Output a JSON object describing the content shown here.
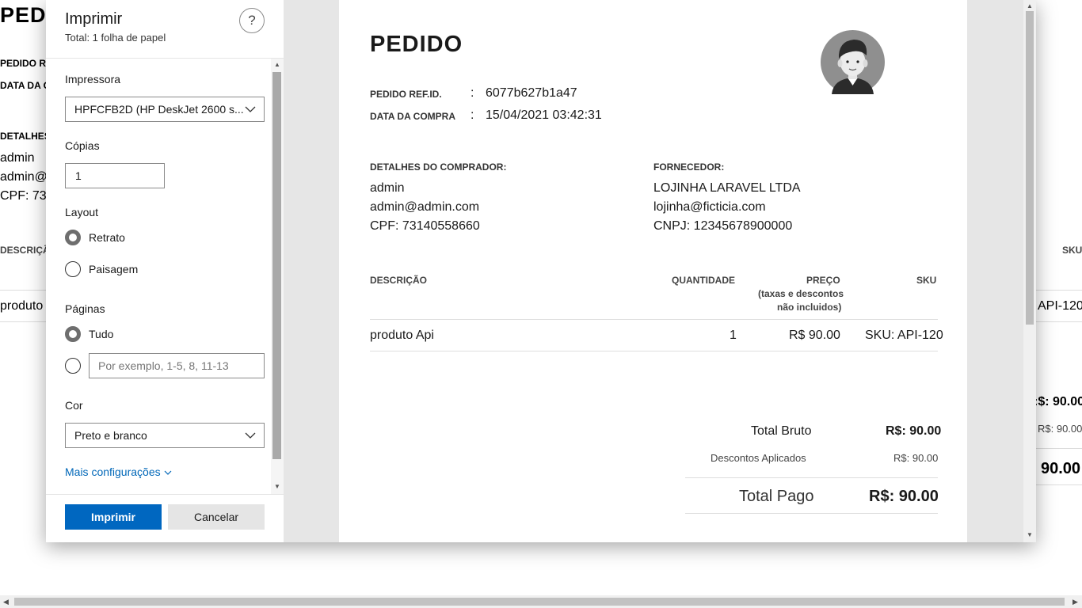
{
  "background_page": {
    "title": "PED",
    "ref_label": "PEDIDO R",
    "date_label": "DATA DA C",
    "buyer_label": "DETALHES",
    "buyer_name": "admin",
    "buyer_email": "admin@",
    "buyer_cpf": "CPF: 731",
    "desc_header": "DESCRIÇÃ",
    "sku_header": "SKU",
    "row_product": "produto",
    "row_sku": "API-120",
    "total_bruto": ":$: 90.00",
    "descontos": "R$: 90.00",
    "total_pago": "90.00"
  },
  "dialog": {
    "title": "Imprimir",
    "subtitle": "Total: 1 folha de papel",
    "help": "?",
    "printer_label": "Impressora",
    "printer_value": "HPFCFB2D (HP DeskJet 2600 s...",
    "copies_label": "Cópias",
    "copies_value": "1",
    "layout_label": "Layout",
    "layout_options": [
      "Retrato",
      "Paisagem"
    ],
    "layout_selected": "Retrato",
    "pages_label": "Páginas",
    "pages_all": "Tudo",
    "pages_placeholder": "Por exemplo, 1-5, 8, 11-13",
    "color_label": "Cor",
    "color_value": "Preto e branco",
    "more_settings": "Mais configurações",
    "print_button": "Imprimir",
    "cancel_button": "Cancelar"
  },
  "preview": {
    "title": "PEDIDO",
    "ref_label": "PEDIDO REF.ID.",
    "ref_value": "6077b627b1a47",
    "date_label": "DATA DA COMPRA",
    "date_value": "15/04/2021 03:42:31",
    "colon": ":",
    "buyer": {
      "label": "DETALHES DO COMPRADOR:",
      "name": "admin",
      "email": "admin@admin.com",
      "doc": "CPF: 73140558660"
    },
    "supplier": {
      "label": "FORNECEDOR:",
      "name": "LOJINHA LARAVEL LTDA",
      "email": "lojinha@ficticia.com",
      "doc": "CNPJ: 12345678900000"
    },
    "table": {
      "headers": {
        "description": "DESCRIÇÃO",
        "quantity": "QUANTIDADE",
        "price": "PREÇO",
        "price_note_1": "(taxas e descontos",
        "price_note_2": "não incluidos)",
        "sku": "SKU"
      },
      "rows": [
        {
          "description": "produto Api",
          "quantity": "1",
          "price": "R$ 90.00",
          "sku": "SKU: API-120"
        }
      ]
    },
    "totals": {
      "bruto_label": "Total Bruto",
      "bruto_value": "R$: 90.00",
      "descontos_label": "Descontos Aplicados",
      "descontos_value": "R$: 90.00",
      "pago_label": "Total Pago",
      "pago_value": "R$: 90.00"
    }
  },
  "colors": {
    "primary_button": "#0067c0",
    "link": "#0067b8",
    "preview_bg": "#e6e6e6"
  }
}
